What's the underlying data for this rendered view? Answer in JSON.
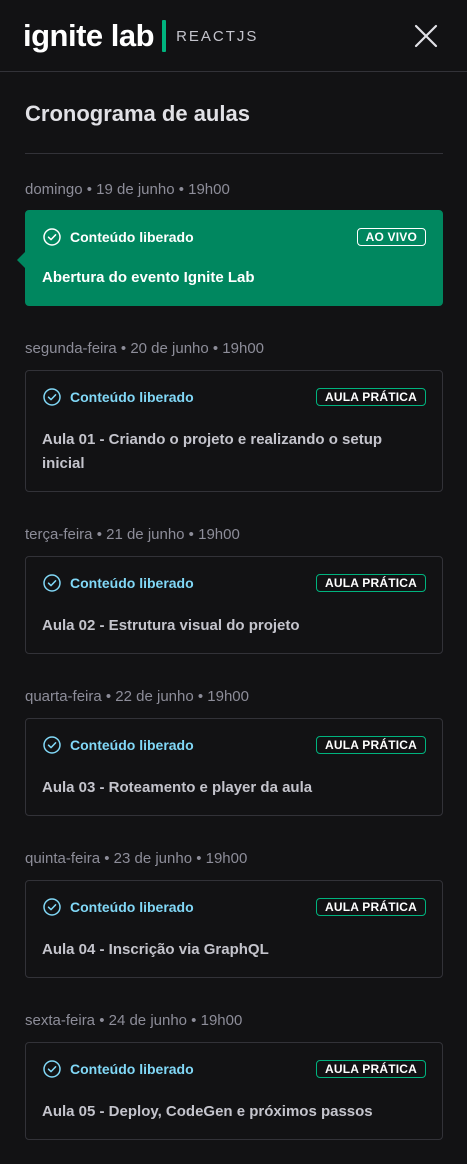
{
  "header": {
    "logo_main": "ignite lab",
    "logo_sub": "REACTJS"
  },
  "sidebar": {
    "title": "Cronograma de aulas",
    "lessons": [
      {
        "date": "domingo • 19 de junho • 19h00",
        "status": "Conteúdo liberado",
        "badge": "AO VIVO",
        "title": "Abertura do evento Ignite Lab",
        "active": true
      },
      {
        "date": "segunda-feira • 20 de junho • 19h00",
        "status": "Conteúdo liberado",
        "badge": "AULA PRÁTICA",
        "title": "Aula 01 - Criando o projeto e realizando o setup inicial",
        "active": false
      },
      {
        "date": "terça-feira • 21 de junho • 19h00",
        "status": "Conteúdo liberado",
        "badge": "AULA PRÁTICA",
        "title": "Aula 02 - Estrutura visual do projeto",
        "active": false
      },
      {
        "date": "quarta-feira • 22 de junho • 19h00",
        "status": "Conteúdo liberado",
        "badge": "AULA PRÁTICA",
        "title": "Aula 03 - Roteamento e player da aula",
        "active": false
      },
      {
        "date": "quinta-feira • 23 de junho • 19h00",
        "status": "Conteúdo liberado",
        "badge": "AULA PRÁTICA",
        "title": "Aula 04 - Inscrição via GraphQL",
        "active": false
      },
      {
        "date": "sexta-feira • 24 de junho • 19h00",
        "status": "Conteúdo liberado",
        "badge": "AULA PRÁTICA",
        "title": "Aula 05 - Deploy, CodeGen e próximos passos",
        "active": false
      }
    ]
  },
  "colors": {
    "background": "#121214",
    "accent": "#00875f",
    "accent_light": "#00b37e",
    "status_blue": "#81d8f7",
    "border": "#323238"
  },
  "icons": {
    "close": "close-icon",
    "check": "check-circle-icon"
  }
}
